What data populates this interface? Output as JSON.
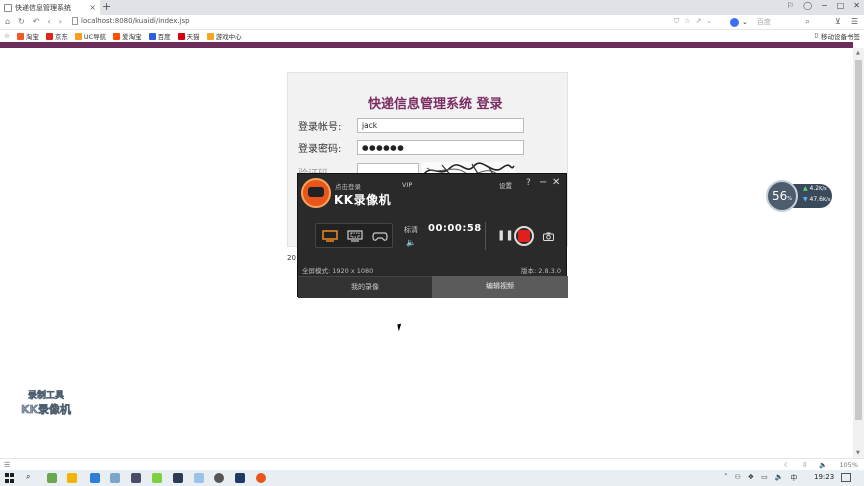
{
  "browser": {
    "tab_title": "快递信息管理系统",
    "tab_close": "×",
    "new_tab": "+",
    "window_buttons": [
      "⚐",
      "◯",
      "−",
      "□",
      "✕"
    ],
    "url": "localhost:8080/kuaidi/index.jsp",
    "search_placeholder": "百度",
    "bookmarks": [
      {
        "label": "淘宝",
        "color": "#f05a24"
      },
      {
        "label": "京东",
        "color": "#e1251b"
      },
      {
        "label": "UC导航",
        "color": "#f79c1d"
      },
      {
        "label": "爱淘宝",
        "color": "#ff5000"
      },
      {
        "label": "百度",
        "color": "#2b5fe0"
      },
      {
        "label": "天猫",
        "color": "#d7000f"
      },
      {
        "label": "游戏中心",
        "color": "#f6a623"
      }
    ],
    "mobile_bookmarks": "移动设备书签",
    "accent_color": "#6c2d5a"
  },
  "login": {
    "title": "快递信息管理系统 登录",
    "username_label": "登录帐号:",
    "username_value": "jack",
    "password_label": "登录密码:",
    "password_value": "●●●●●●",
    "captcha_label": "验证码",
    "footer_partial": "20"
  },
  "recorder": {
    "login": "点击登录",
    "vip": "VIP",
    "title": "KK录像机",
    "settings": "设置",
    "help": "?",
    "minimize": "−",
    "close": "✕",
    "quality": "标清",
    "timer": "00:00:58",
    "fullscreen_mode": "全屏模式: 1920 x 1080",
    "version": "版本: 2.8.3.0",
    "tab_my_recordings": "我的录像",
    "tab_edit_video": "编辑视频"
  },
  "speed_widget": {
    "percent": "56",
    "percent_unit": "%",
    "upload": "4.2",
    "upload_unit": "K/s",
    "download": "47.6",
    "download_unit": "K/s"
  },
  "watermark": {
    "line1": "录制工具",
    "line2": "KK录像机"
  },
  "statusbar": {
    "zoom": "105%"
  },
  "taskbar": {
    "time": "19:23",
    "ime": "中"
  }
}
